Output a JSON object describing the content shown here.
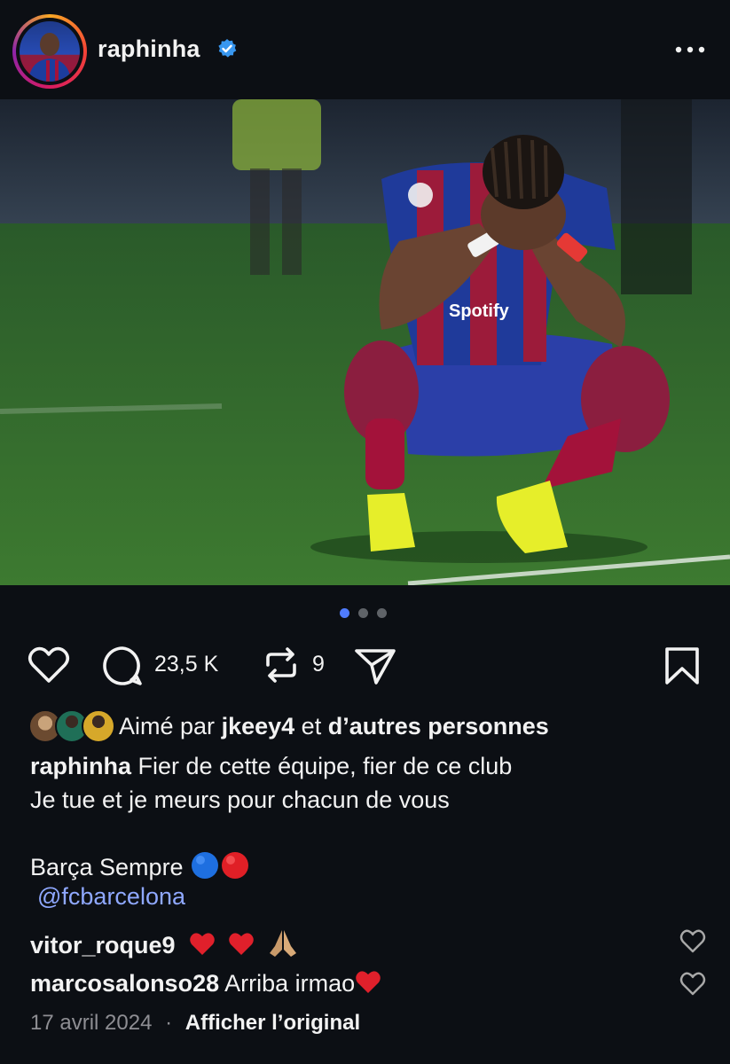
{
  "header": {
    "username": "raphinha",
    "verified": true,
    "more_icon": "more-horizontal-icon"
  },
  "carousel": {
    "dot_count": 3,
    "active_index": 0,
    "active_color": "#4f7cff",
    "inactive_color": "#5f6368"
  },
  "actions": {
    "like_icon": "heart-outline-icon",
    "comment_icon": "comment-bubble-icon",
    "comment_count": "23,5 K",
    "repost_icon": "repost-icon",
    "repost_count": "9",
    "share_icon": "send-icon",
    "save_icon": "bookmark-icon"
  },
  "likes": {
    "prefix": "Aimé par",
    "user": "jkeey4",
    "connector": "et",
    "others": "d’autres personnes"
  },
  "caption": {
    "user": "raphinha",
    "line1": "Fier de cette équipe, fier de ce club",
    "line2": "Je tue et je meurs pour chacun de vous",
    "line3": "Barça Sempre",
    "mention": "@fcbarcelona"
  },
  "comments": [
    {
      "user": "vitor_roque9",
      "text": ""
    },
    {
      "user": "marcosalonso28",
      "text": "Arriba irmao"
    }
  ],
  "footer": {
    "date": "17 avril 2024",
    "separator": "·",
    "original_link": "Afficher l’original"
  },
  "colors": {
    "background": "#0c0f14",
    "text": "#f2f2f2",
    "link": "#8fa8ff",
    "verified": "#3897f0",
    "muted": "#8e8e93"
  }
}
